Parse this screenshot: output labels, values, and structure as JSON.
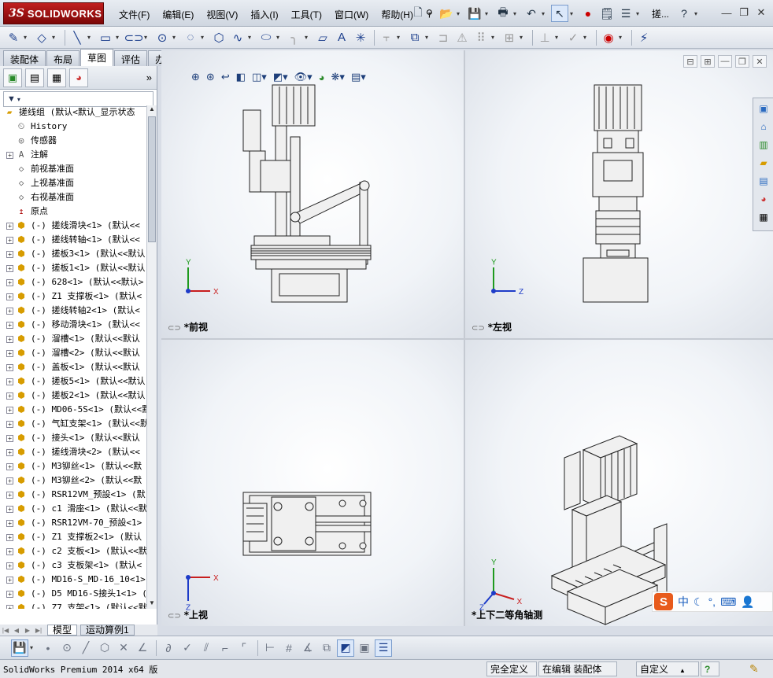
{
  "app": {
    "logo_prefix": "3S",
    "logo_name": "SOLIDWORKS",
    "doc_short_title": "搓..."
  },
  "menu": [
    "文件(F)",
    "编辑(E)",
    "视图(V)",
    "插入(I)",
    "工具(T)",
    "窗口(W)",
    "帮助(H)"
  ],
  "cm_tabs": [
    "装配体",
    "布局",
    "草图",
    "评估",
    "办公室产品"
  ],
  "cm_active": "草图",
  "filter_icon": "funnel-icon",
  "tree": [
    {
      "label": "搓线组  (默认<默认_显示状态",
      "icon": "assembly",
      "exp": false
    },
    {
      "label": "History",
      "icon": "history",
      "exp": false
    },
    {
      "label": "传感器",
      "icon": "sensor",
      "exp": false
    },
    {
      "label": "注解",
      "icon": "annotation",
      "exp": true
    },
    {
      "label": "前视基准面",
      "icon": "plane",
      "exp": false
    },
    {
      "label": "上视基准面",
      "icon": "plane",
      "exp": false
    },
    {
      "label": "右视基准面",
      "icon": "plane",
      "exp": false
    },
    {
      "label": "原点",
      "icon": "origin",
      "exp": false
    },
    {
      "label": "(-) 搓线滑块<1> (默认<<",
      "icon": "comp",
      "exp": true
    },
    {
      "label": "(-) 搓线转轴<1> (默认<<",
      "icon": "comp",
      "exp": true
    },
    {
      "label": "(-) 搓板3<1> (默认<<默认",
      "icon": "comp",
      "exp": true
    },
    {
      "label": "(-) 搓板1<1> (默认<<默认",
      "icon": "comp",
      "exp": true
    },
    {
      "label": "(-) 628<1> (默认<<默认>",
      "icon": "comp",
      "exp": true
    },
    {
      "label": "(-) Z1 支撑板<1> (默认<",
      "icon": "comp",
      "exp": true
    },
    {
      "label": "(-) 搓线转轴2<1> (默认<",
      "icon": "comp",
      "exp": true
    },
    {
      "label": "(-) 移动滑块<1> (默认<<",
      "icon": "comp",
      "exp": true
    },
    {
      "label": "(-) 溜槽<1> (默认<<默认",
      "icon": "comp",
      "exp": true
    },
    {
      "label": "(-) 溜槽<2> (默认<<默认",
      "icon": "comp",
      "exp": true
    },
    {
      "label": "(-) 盖板<1> (默认<<默认",
      "icon": "comp",
      "exp": true
    },
    {
      "label": "(-) 搓板5<1> (默认<<默认",
      "icon": "comp",
      "exp": true
    },
    {
      "label": "(-) 搓板2<1> (默认<<默认",
      "icon": "comp",
      "exp": true
    },
    {
      "label": "(-) MD06-5S<1> (默认<<默",
      "icon": "comp",
      "exp": true
    },
    {
      "label": "(-) 气缸支架<1> (默认<<默",
      "icon": "comp",
      "exp": true
    },
    {
      "label": "(-) 接头<1> (默认<<默认",
      "icon": "comp",
      "exp": true
    },
    {
      "label": "(-) 搓线滑块<2> (默认<<",
      "icon": "comp",
      "exp": true
    },
    {
      "label": "(-) M3铆丝<1> (默认<<默",
      "icon": "comp",
      "exp": true
    },
    {
      "label": "(-) M3铆丝<2> (默认<<默",
      "icon": "comp",
      "exp": true
    },
    {
      "label": "(-) RSR12VM_预設<1> (默",
      "icon": "comp",
      "exp": true
    },
    {
      "label": "(-) c1 滑座<1> (默认<<默",
      "icon": "comp",
      "exp": true
    },
    {
      "label": "(-) RSR12VM-70_预設<1>",
      "icon": "comp",
      "exp": true
    },
    {
      "label": "(-) Z1 支撑板2<1> (默认",
      "icon": "comp",
      "exp": true
    },
    {
      "label": "(-) c2 支板<1> (默认<<默",
      "icon": "comp",
      "exp": true
    },
    {
      "label": "(-) c3 支板架<1> (默认<",
      "icon": "comp",
      "exp": true
    },
    {
      "label": "(-) MD16-S_MD-16_10<1>",
      "icon": "comp",
      "exp": true
    },
    {
      "label": "(-) D5 MD16-S接头1<1> (",
      "icon": "comp",
      "exp": true
    },
    {
      "label": "(-) Z7 支架<1> (默认<<默",
      "icon": "comp",
      "exp": true
    }
  ],
  "model_tabs": [
    "模型",
    "运动算例1"
  ],
  "viewports": {
    "front": "*前视",
    "left": "*左视",
    "top": "*上视",
    "iso": "*上下二等角轴测"
  },
  "axes": {
    "front": [
      "Y",
      "X"
    ],
    "left": [
      "Y",
      "Z"
    ],
    "top": [
      "X",
      "Z"
    ],
    "iso": [
      "Y",
      "X",
      "Z"
    ]
  },
  "status": {
    "app_version": "SolidWorks Premium 2014 x64 版",
    "defined": "完全定义",
    "editing": "在编辑 装配体",
    "units": "自定义",
    "help_icon": "?"
  },
  "ime": {
    "logo": "S",
    "mode": "中"
  },
  "colors": {
    "brand": "#a31515",
    "model_fill": "#f0f0f0",
    "model_stroke": "#222222",
    "axis_x": "#c81e1e",
    "axis_y": "#1e9a1e",
    "axis_z": "#1e3cc8"
  }
}
